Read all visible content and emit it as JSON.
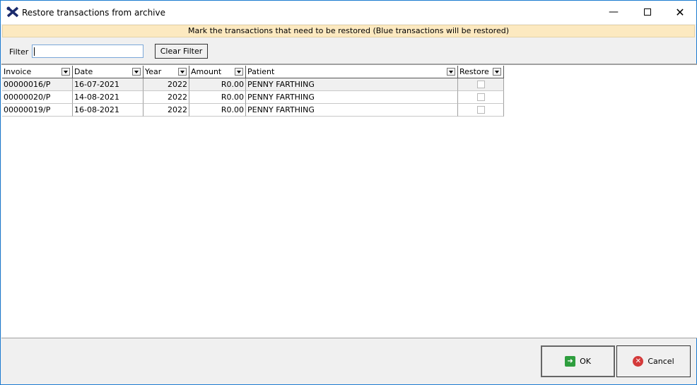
{
  "window": {
    "title": "Restore transactions from archive"
  },
  "banner": "Mark the transactions that need to be restored (Blue transactions will be restored)",
  "filter": {
    "label": "Filter",
    "value": "",
    "clear_label": "Clear Filter"
  },
  "columns": [
    "Invoice",
    "Date",
    "Year",
    "Amount",
    "Patient",
    "Restore"
  ],
  "rows": [
    {
      "invoice": "00000016/P",
      "date": "16-07-2021",
      "year": "2022",
      "amount": "R0.00",
      "patient": "PENNY FARTHING",
      "restore": false
    },
    {
      "invoice": "00000020/P",
      "date": "14-08-2021",
      "year": "2022",
      "amount": "R0.00",
      "patient": "PENNY FARTHING",
      "restore": false
    },
    {
      "invoice": "00000019/P",
      "date": "16-08-2021",
      "year": "2022",
      "amount": "R0.00",
      "patient": "PENNY FARTHING",
      "restore": false
    }
  ],
  "buttons": {
    "ok": "OK",
    "cancel": "Cancel"
  }
}
